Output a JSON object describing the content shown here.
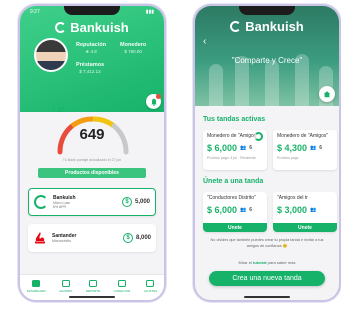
{
  "colors": {
    "brand": "#17b26a",
    "brand_light": "#3fd08a",
    "danger": "#e74c3c"
  },
  "left_screen": {
    "status_time": "9:27",
    "brand_name": "Bankuish",
    "stats": [
      {
        "label": "Reputación",
        "value": "★ 4.8"
      },
      {
        "label": "Monedero",
        "value": "$ 750.00"
      },
      {
        "label": "Préstamos",
        "value": "$ 7,412.12"
      }
    ],
    "score_delta": "+ 27",
    "score": "649",
    "score_updated": "Tu Bank puntaje actualizado el 27 jun",
    "products_title": "Productos disponibles",
    "products": [
      {
        "name": "Bankuish",
        "sub1": "Micro Loan",
        "sub2": "6% APR",
        "amount": "5,000"
      },
      {
        "name": "Santander",
        "sub1": "Microcrédito",
        "sub2": "",
        "amount": "8,000"
      }
    ],
    "tabs": [
      {
        "label": "DASHBOARD",
        "icon": "dashboard-icon"
      },
      {
        "label": "AHORRO",
        "icon": "savings-icon"
      },
      {
        "label": "REPORTE",
        "icon": "report-icon"
      },
      {
        "label": "CONECTAR",
        "icon": "connect-icon"
      },
      {
        "label": "AJUSTES",
        "icon": "settings-icon"
      }
    ]
  },
  "right_screen": {
    "brand_name": "Bankuish",
    "tagline": "\"Comparte y Crece\"",
    "active_title": "Tus tandas activas",
    "active_tandas": [
      {
        "name": "Monedero de \"Amigos\"",
        "amount": "$ 6,000",
        "count": "6",
        "sub": "Próximo pago: 4 jul · Pendiente"
      },
      {
        "name": "Monedero de \"Amigos\"",
        "amount": "$ 4,300",
        "count": "6",
        "sub": "Próximo pago"
      }
    ],
    "join_title": "Únete a una tanda",
    "join_tandas": [
      {
        "name": "\"Conductores Distrito\"",
        "amount": "$ 6,000",
        "count": "6",
        "button": "Unete"
      },
      {
        "name": "\"Amigos del tr",
        "amount": "$ 3,000",
        "count": "",
        "button": "Unete"
      }
    ],
    "info_note": "No olvides que también puedes crear tu propia tanda e invitar a tus amigos de confianza 😊",
    "tutorial_prefix": "Mirar el",
    "tutorial_link": "tutorial",
    "tutorial_suffix": "para saber más",
    "create_button": "Crea una nueva tanda"
  }
}
